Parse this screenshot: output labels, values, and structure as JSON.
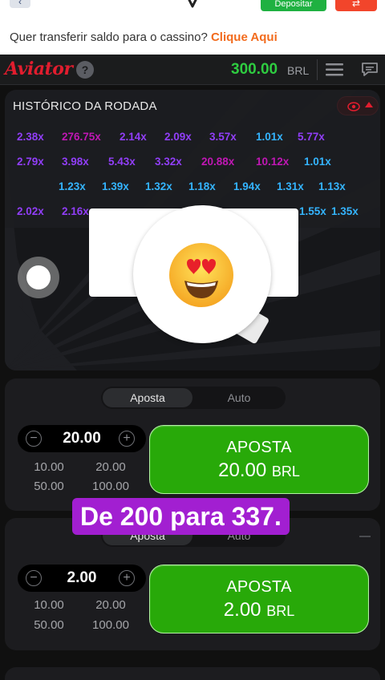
{
  "topbar": {
    "deposit_label": "Depositar",
    "transfer_text": "Quer transferir saldo para o cassino?",
    "transfer_link": "Clique Aqui"
  },
  "header": {
    "logo": "Aviator",
    "help": "?",
    "balance": "300.00",
    "currency": "BRL"
  },
  "history": {
    "title": "HISTÓRICO DA RODADA",
    "rows": [
      [
        {
          "v": "2.38x",
          "c": "purple"
        },
        {
          "v": "276.75x",
          "c": "pink"
        },
        {
          "v": "2.14x",
          "c": "purple"
        },
        {
          "v": "2.09x",
          "c": "purple"
        },
        {
          "v": "3.57x",
          "c": "purple"
        },
        {
          "v": "1.01x",
          "c": "blue"
        },
        {
          "v": "5.77x",
          "c": "purple"
        }
      ],
      [
        {
          "v": "2.79x",
          "c": "purple"
        },
        {
          "v": "3.98x",
          "c": "purple"
        },
        {
          "v": "5.43x",
          "c": "purple"
        },
        {
          "v": "3.32x",
          "c": "purple"
        },
        {
          "v": "20.88x",
          "c": "pink"
        },
        {
          "v": "10.12x",
          "c": "pink"
        },
        {
          "v": "1.01x",
          "c": "blue"
        }
      ],
      [
        {
          "v": "1.23x",
          "c": "blue"
        },
        {
          "v": "1.39x",
          "c": "blue"
        },
        {
          "v": "1.32x",
          "c": "blue"
        },
        {
          "v": "1.18x",
          "c": "blue"
        },
        {
          "v": "1.94x",
          "c": "blue"
        },
        {
          "v": "1.31x",
          "c": "blue"
        },
        {
          "v": "1.13x",
          "c": "blue"
        }
      ],
      [
        {
          "v": "2.02x",
          "c": "purple"
        },
        {
          "v": "2.16x",
          "c": "purple"
        },
        {
          "v": "1.55x",
          "c": "blue"
        },
        {
          "v": "1.35x",
          "c": "blue"
        }
      ]
    ]
  },
  "bets": [
    {
      "tab_bet": "Aposta",
      "tab_auto": "Auto",
      "stake": "20.00",
      "quick": [
        "10.00",
        "20.00",
        "50.00",
        "100.00"
      ],
      "button_label": "APOSTA",
      "button_amount": "20.00",
      "button_currency": "BRL"
    },
    {
      "tab_bet": "Aposta",
      "tab_auto": "Auto",
      "stake": "2.00",
      "quick": [
        "10.00",
        "20.00",
        "50.00",
        "100.00"
      ],
      "button_label": "APOSTA",
      "button_amount": "2.00",
      "button_currency": "BRL"
    }
  ],
  "caption": "De 200 para 337.",
  "colors": {
    "bet_green": "#28a909",
    "balance_green": "#2ecc40",
    "brand_red": "#e11d2e",
    "caption_purple": "#a21fd1"
  }
}
